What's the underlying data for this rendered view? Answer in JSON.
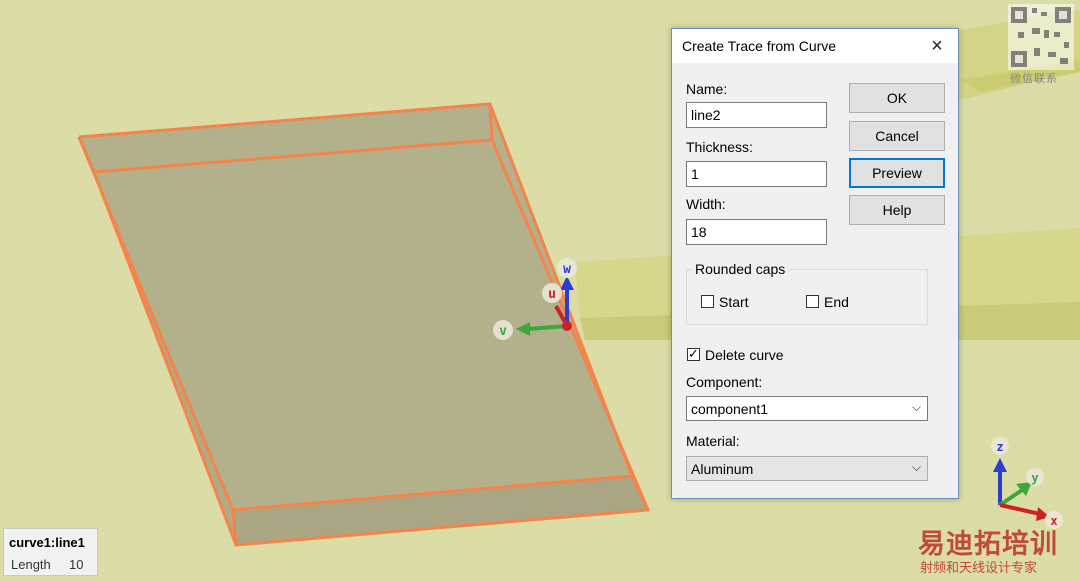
{
  "dialog": {
    "title": "Create Trace from Curve",
    "close_glyph": "×",
    "name_label": "Name:",
    "name_value": "line2",
    "thickness_label": "Thickness:",
    "thickness_value": "1",
    "width_label": "Width:",
    "width_value": "18",
    "ok_label": "OK",
    "cancel_label": "Cancel",
    "preview_label": "Preview",
    "help_label": "Help",
    "rounded_caps_label": "Rounded caps",
    "start_label": "Start",
    "start_checked": false,
    "end_label": "End",
    "end_checked": false,
    "delete_curve_label": "Delete curve",
    "delete_curve_checked": true,
    "component_label": "Component:",
    "component_value": "component1",
    "material_label": "Material:",
    "material_value": "Aluminum",
    "dropdown_glyph": "⌵"
  },
  "viewport": {
    "gizmo": {
      "w_label": "w",
      "u_label": "u",
      "v_label": "v"
    },
    "axis_triad": {
      "z_label": "z",
      "y_label": "y",
      "x_label": "x"
    },
    "colors": {
      "background": "#dcdca6",
      "board_fill": "#b3b08c",
      "board_edge": "#f5844a",
      "trace_fill": "#d6d68a",
      "axis_blue": "#2d3dcf",
      "axis_green": "#3aa83a",
      "axis_red": "#cc2222"
    }
  },
  "status": {
    "object_name": "curve1:line1",
    "length_label": "Length",
    "length_value": "10"
  },
  "watermark": {
    "qr_caption": "微信联系",
    "brand": "易迪拓培训",
    "brand_sub": "射频和天线设计专家"
  }
}
